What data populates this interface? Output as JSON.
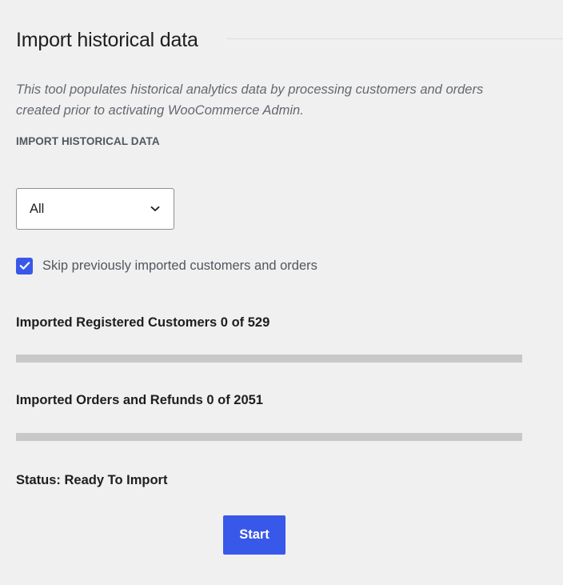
{
  "header": {
    "title": "Import historical data"
  },
  "description": "This tool populates historical analytics data by processing customers and orders created prior to activating WooCommerce Admin.",
  "import_field": {
    "label": "IMPORT HISTORICAL DATA",
    "selected_value": "All",
    "icon": "chevron-down-icon"
  },
  "skip_option": {
    "label": "Skip previously imported customers and orders",
    "checked": true,
    "icon": "checkmark-icon"
  },
  "progress": {
    "customers": {
      "label": "Imported Registered Customers 0 of 529",
      "fraction": 0
    },
    "orders": {
      "label": "Imported Orders and Refunds 0 of 2051",
      "fraction": 0
    }
  },
  "status": {
    "text": "Status: Ready To Import"
  },
  "actions": {
    "start_label": "Start"
  },
  "colors": {
    "accent": "#3858e9",
    "background": "#f0f0f0",
    "progress_track": "#c8c8c8"
  }
}
